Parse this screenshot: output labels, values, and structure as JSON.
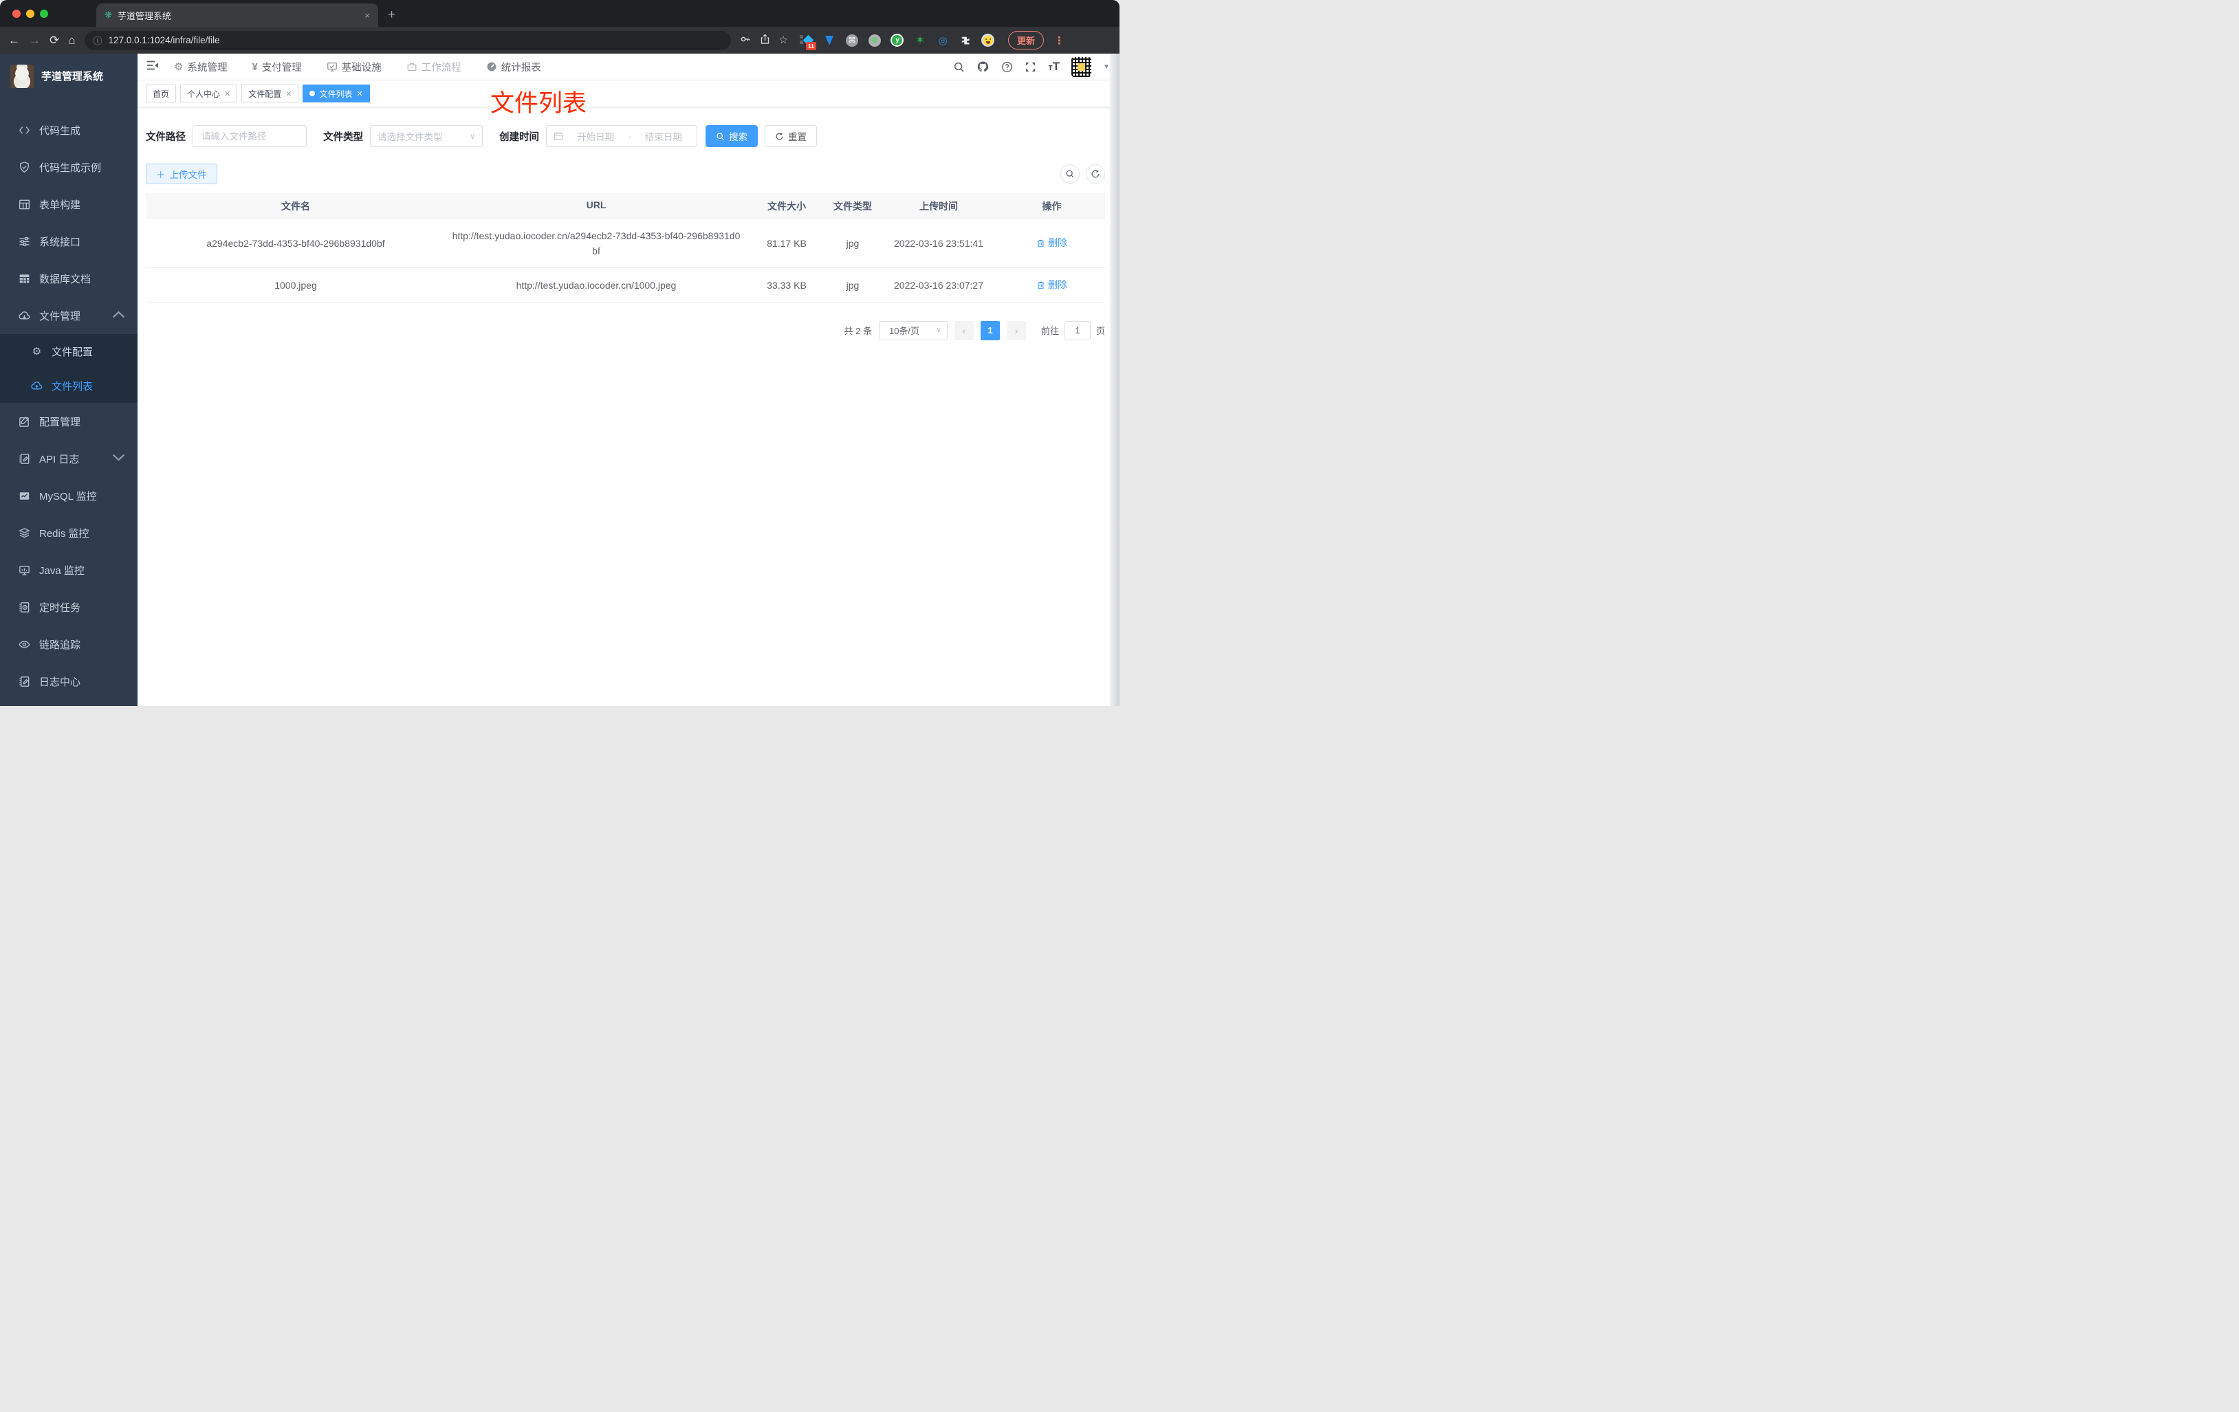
{
  "browser": {
    "tab_title": "芋道管理系统",
    "close_tab": "×",
    "new_tab": "+",
    "url": "127.0.0.1:1024/infra/file/file",
    "ext_badge": "11",
    "update_label": "更新"
  },
  "header": {
    "nav": [
      {
        "label": "系统管理"
      },
      {
        "label": "支付管理"
      },
      {
        "label": "基础设施"
      },
      {
        "label": "工作流程"
      },
      {
        "label": "统计报表"
      }
    ]
  },
  "tags": [
    {
      "label": "首页"
    },
    {
      "label": "个人中心"
    },
    {
      "label": "文件配置"
    },
    {
      "label": "文件列表"
    }
  ],
  "annotation": "文件列表",
  "sidebar": {
    "title": "芋道管理系统",
    "items": [
      {
        "label": "代码生成"
      },
      {
        "label": "代码生成示例"
      },
      {
        "label": "表单构建"
      },
      {
        "label": "系统接口"
      },
      {
        "label": "数据库文档"
      },
      {
        "label": "文件管理"
      },
      {
        "label": "文件配置"
      },
      {
        "label": "文件列表"
      },
      {
        "label": "配置管理"
      },
      {
        "label": "API 日志"
      },
      {
        "label": "MySQL 监控"
      },
      {
        "label": "Redis 监控"
      },
      {
        "label": "Java 监控"
      },
      {
        "label": "定时任务"
      },
      {
        "label": "链路追踪"
      },
      {
        "label": "日志中心"
      }
    ]
  },
  "filters": {
    "path_label": "文件路径",
    "path_placeholder": "请输入文件路径",
    "type_label": "文件类型",
    "type_placeholder": "请选择文件类型",
    "time_label": "创建时间",
    "start_placeholder": "开始日期",
    "separator": "-",
    "end_placeholder": "结束日期",
    "search_label": "搜索",
    "reset_label": "重置"
  },
  "toolbar": {
    "upload_label": "上传文件"
  },
  "table": {
    "columns": [
      "文件名",
      "URL",
      "文件大小",
      "文件类型",
      "上传时间",
      "操作"
    ],
    "rows": [
      {
        "name": "a294ecb2-73dd-4353-bf40-296b8931d0bf",
        "url": "http://test.yudao.iocoder.cn/a294ecb2-73dd-4353-bf40-296b8931d0bf",
        "size": "81.17 KB",
        "type": "jpg",
        "time": "2022-03-16 23:51:41",
        "action": "删除"
      },
      {
        "name": "1000.jpeg",
        "url": "http://test.yudao.iocoder.cn/1000.jpeg",
        "size": "33.33 KB",
        "type": "jpg",
        "time": "2022-03-16 23:07:27",
        "action": "删除"
      }
    ]
  },
  "pagination": {
    "total": "共 2 条",
    "page_size": "10条/页",
    "prev": "‹",
    "next": "›",
    "current": "1",
    "goto_label": "前往",
    "goto_value": "1",
    "unit": "页"
  },
  "colors": {
    "accent": "#409eff",
    "sidebar_bg": "#2f3c4d",
    "submenu_bg": "#202e3e",
    "annotation": "#ff2d00",
    "active_tag_bg": "#409eff",
    "update_button": "#ec8075",
    "table_header_bg": "#f8f8f9"
  }
}
